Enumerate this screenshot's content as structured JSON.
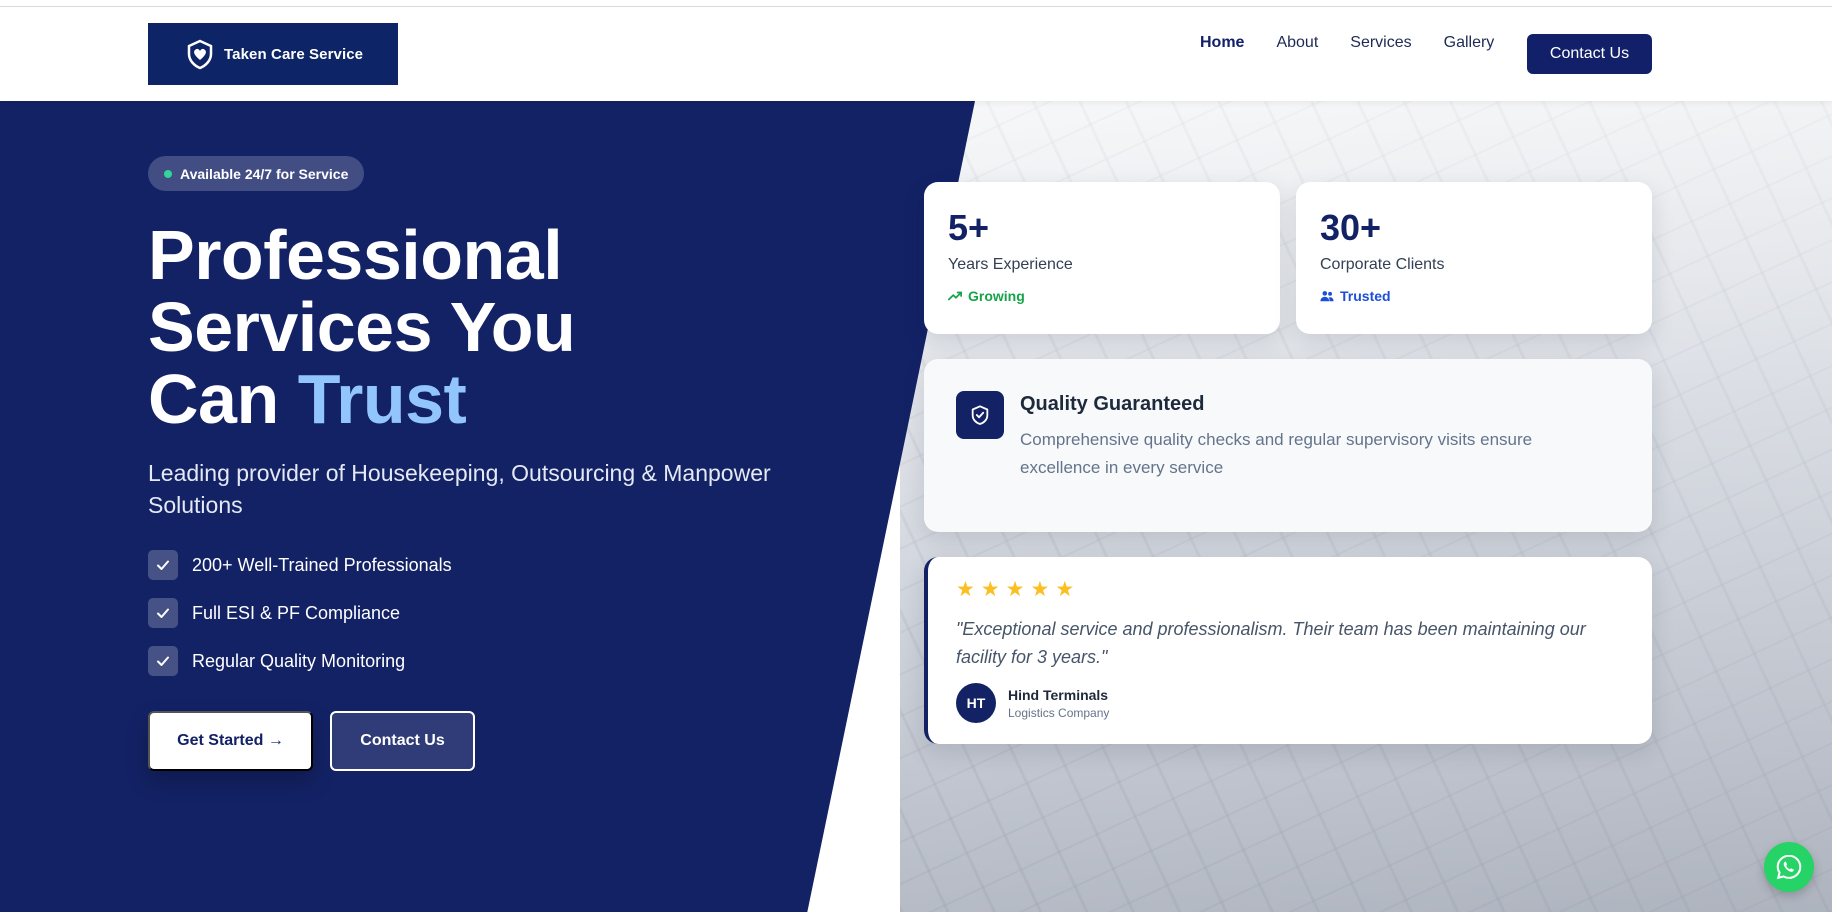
{
  "header": {
    "logo_text": "Taken Care Service",
    "nav": [
      "Home",
      "About",
      "Services",
      "Gallery"
    ],
    "contact_label": "Contact Us"
  },
  "hero": {
    "badge": "Available 24/7 for Service",
    "title_line1": "Professional",
    "title_line2": "Services You",
    "title_line3_prefix": "Can ",
    "title_accent": "Trust",
    "subtitle": "Leading provider of Housekeeping, Outsourcing & Manpower Solutions",
    "features": [
      "200+ Well-Trained Professionals",
      "Full ESI & PF Compliance",
      "Regular Quality Monitoring"
    ],
    "get_started_label": "Get Started →",
    "contact_label": "Contact Us"
  },
  "stats": [
    {
      "number": "5+",
      "label": "Years Experience",
      "tag": "Growing",
      "tag_icon": "trending-up-icon"
    },
    {
      "number": "30+",
      "label": "Corporate Clients",
      "tag": "Trusted",
      "tag_icon": "users-icon"
    }
  ],
  "quality": {
    "icon": "shield-check-icon",
    "title": "Quality Guaranteed",
    "text": "Comprehensive quality checks and regular supervisory visits ensure excellence in every service"
  },
  "review": {
    "stars": 5,
    "quote": "\"Exceptional service and professionalism. Their team has been maintaining our facility for 3 years.\"",
    "initials": "HT",
    "name": "Hind Terminals",
    "role": "Logistics Company"
  },
  "colors": {
    "brand_navy": "#132265",
    "accent_blue": "#93c5fd",
    "success_green": "#16a34a",
    "star_yellow": "#fbbf24",
    "whatsapp_green": "#25d366"
  }
}
